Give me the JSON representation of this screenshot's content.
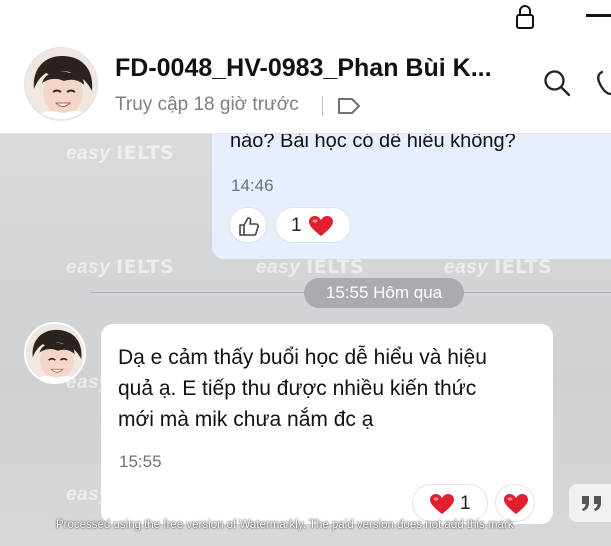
{
  "system": {
    "lock_icon": "lock-icon",
    "minimize_icon": "minimize-icon"
  },
  "header": {
    "title": "FD-0048_HV-0983_Phan Bùi K...",
    "status": "Truy cập 18 giờ trước",
    "tag_icon": "tag-icon",
    "search_icon": "search-icon",
    "phone_icon": "phone-icon"
  },
  "watermark": {
    "easy": "easy",
    "ielts": "IELTS"
  },
  "messages": {
    "outgoing": {
      "text_partial": "nào? Bài học có dễ hiểu không?",
      "time": "14:46",
      "reaction_count": "1"
    },
    "separator": "15:55 Hôm qua",
    "incoming": {
      "lines": [
        "Dạ e cảm thấy buổi học dễ hiểu và hiệu",
        "quả ạ. E tiếp thu được nhiều kiến thức",
        "mới mà mik chưa nắm đc ạ"
      ],
      "time": "15:55",
      "reaction_count": "1"
    }
  },
  "processed_note": "Processed using the free version of Watermarkly. The paid version does not add this mark",
  "colors": {
    "outgoing_bubble": "#e5efff",
    "incoming_bubble": "#ffffff",
    "heart": "#e0202f",
    "chat_bg": "#d3d5d8"
  }
}
